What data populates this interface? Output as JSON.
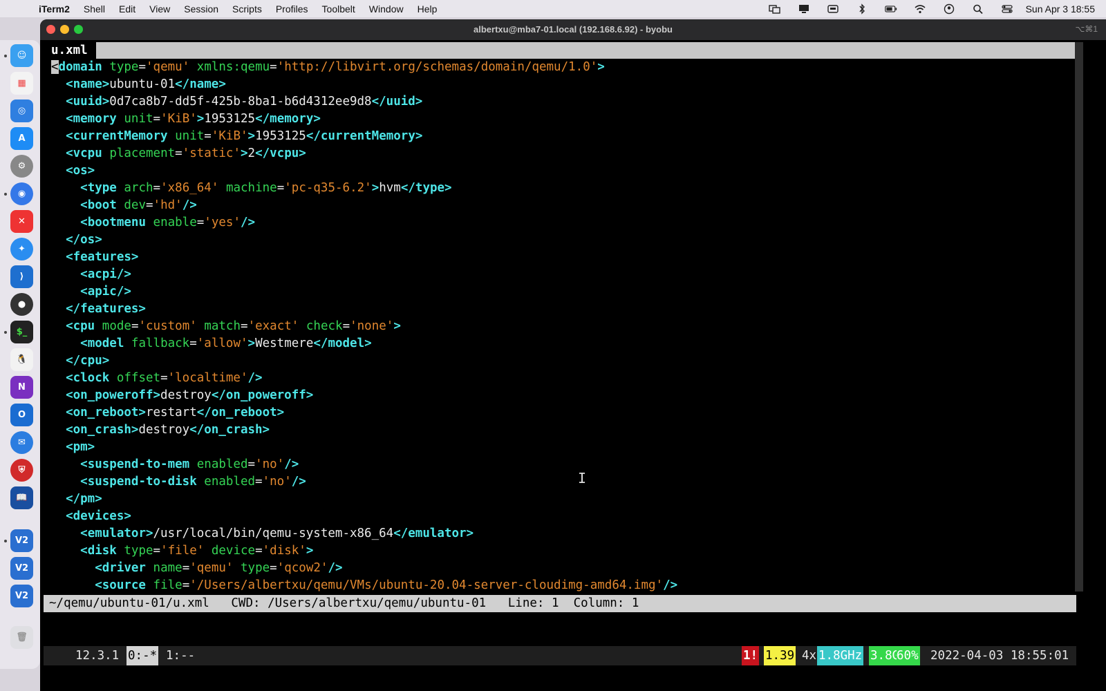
{
  "menubar": {
    "app_name": "iTerm2",
    "items": [
      "Shell",
      "Edit",
      "View",
      "Session",
      "Scripts",
      "Profiles",
      "Toolbelt",
      "Window",
      "Help"
    ],
    "clock": "Sun Apr 3  18:55"
  },
  "window": {
    "title": "albertxu@mba7-01.local (192.168.6.92) - byobu",
    "shortcut": "⌥⌘1"
  },
  "editor": {
    "tab_name": "u.xml",
    "lines": [
      [
        [
          "cursor",
          "<"
        ],
        [
          "tg",
          "domain"
        ],
        [
          "tx",
          " "
        ],
        [
          "at",
          "type"
        ],
        [
          "tx",
          "="
        ],
        [
          "vl",
          "'qemu'"
        ],
        [
          "tx",
          " "
        ],
        [
          "at",
          "xmlns:qemu"
        ],
        [
          "tx",
          "="
        ],
        [
          "vl",
          "'http://libvirt.org/schemas/domain/qemu/1.0'"
        ],
        [
          "tg",
          ">"
        ]
      ],
      [
        [
          "tx",
          "  "
        ],
        [
          "tg",
          "<name>"
        ],
        [
          "tx",
          "ubuntu-01"
        ],
        [
          "tg",
          "</name>"
        ]
      ],
      [
        [
          "tx",
          "  "
        ],
        [
          "tg",
          "<uuid>"
        ],
        [
          "tx",
          "0d7ca8b7-dd5f-425b-8ba1-b6d4312ee9d8"
        ],
        [
          "tg",
          "</uuid>"
        ]
      ],
      [
        [
          "tx",
          "  "
        ],
        [
          "tg",
          "<memory"
        ],
        [
          "tx",
          " "
        ],
        [
          "at",
          "unit"
        ],
        [
          "tx",
          "="
        ],
        [
          "vl",
          "'KiB'"
        ],
        [
          "tg",
          ">"
        ],
        [
          "tx",
          "1953125"
        ],
        [
          "tg",
          "</memory>"
        ]
      ],
      [
        [
          "tx",
          "  "
        ],
        [
          "tg",
          "<currentMemory"
        ],
        [
          "tx",
          " "
        ],
        [
          "at",
          "unit"
        ],
        [
          "tx",
          "="
        ],
        [
          "vl",
          "'KiB'"
        ],
        [
          "tg",
          ">"
        ],
        [
          "tx",
          "1953125"
        ],
        [
          "tg",
          "</currentMemory>"
        ]
      ],
      [
        [
          "tx",
          "  "
        ],
        [
          "tg",
          "<vcpu"
        ],
        [
          "tx",
          " "
        ],
        [
          "at",
          "placement"
        ],
        [
          "tx",
          "="
        ],
        [
          "vl",
          "'static'"
        ],
        [
          "tg",
          ">"
        ],
        [
          "tx",
          "2"
        ],
        [
          "tg",
          "</vcpu>"
        ]
      ],
      [
        [
          "tx",
          "  "
        ],
        [
          "tg",
          "<os>"
        ]
      ],
      [
        [
          "tx",
          "    "
        ],
        [
          "tg",
          "<type"
        ],
        [
          "tx",
          " "
        ],
        [
          "at",
          "arch"
        ],
        [
          "tx",
          "="
        ],
        [
          "vl",
          "'x86_64'"
        ],
        [
          "tx",
          " "
        ],
        [
          "at",
          "machine"
        ],
        [
          "tx",
          "="
        ],
        [
          "vl",
          "'pc-q35-6.2'"
        ],
        [
          "tg",
          ">"
        ],
        [
          "tx",
          "hvm"
        ],
        [
          "tg",
          "</type>"
        ]
      ],
      [
        [
          "tx",
          "    "
        ],
        [
          "tg",
          "<boot"
        ],
        [
          "tx",
          " "
        ],
        [
          "at",
          "dev"
        ],
        [
          "tx",
          "="
        ],
        [
          "vl",
          "'hd'"
        ],
        [
          "tg",
          "/>"
        ]
      ],
      [
        [
          "tx",
          "    "
        ],
        [
          "tg",
          "<bootmenu"
        ],
        [
          "tx",
          " "
        ],
        [
          "at",
          "enable"
        ],
        [
          "tx",
          "="
        ],
        [
          "vl",
          "'yes'"
        ],
        [
          "tg",
          "/>"
        ]
      ],
      [
        [
          "tx",
          "  "
        ],
        [
          "tg",
          "</os>"
        ]
      ],
      [
        [
          "tx",
          "  "
        ],
        [
          "tg",
          "<features>"
        ]
      ],
      [
        [
          "tx",
          "    "
        ],
        [
          "tg",
          "<acpi/>"
        ]
      ],
      [
        [
          "tx",
          "    "
        ],
        [
          "tg",
          "<apic/>"
        ]
      ],
      [
        [
          "tx",
          "  "
        ],
        [
          "tg",
          "</features>"
        ]
      ],
      [
        [
          "tx",
          "  "
        ],
        [
          "tg",
          "<cpu"
        ],
        [
          "tx",
          " "
        ],
        [
          "at",
          "mode"
        ],
        [
          "tx",
          "="
        ],
        [
          "vl",
          "'custom'"
        ],
        [
          "tx",
          " "
        ],
        [
          "at",
          "match"
        ],
        [
          "tx",
          "="
        ],
        [
          "vl",
          "'exact'"
        ],
        [
          "tx",
          " "
        ],
        [
          "at",
          "check"
        ],
        [
          "tx",
          "="
        ],
        [
          "vl",
          "'none'"
        ],
        [
          "tg",
          ">"
        ]
      ],
      [
        [
          "tx",
          "    "
        ],
        [
          "tg",
          "<model"
        ],
        [
          "tx",
          " "
        ],
        [
          "at",
          "fallback"
        ],
        [
          "tx",
          "="
        ],
        [
          "vl",
          "'allow'"
        ],
        [
          "tg",
          ">"
        ],
        [
          "tx",
          "Westmere"
        ],
        [
          "tg",
          "</model>"
        ]
      ],
      [
        [
          "tx",
          "  "
        ],
        [
          "tg",
          "</cpu>"
        ]
      ],
      [
        [
          "tx",
          "  "
        ],
        [
          "tg",
          "<clock"
        ],
        [
          "tx",
          " "
        ],
        [
          "at",
          "offset"
        ],
        [
          "tx",
          "="
        ],
        [
          "vl",
          "'localtime'"
        ],
        [
          "tg",
          "/>"
        ]
      ],
      [
        [
          "tx",
          "  "
        ],
        [
          "tg",
          "<on_poweroff>"
        ],
        [
          "tx",
          "destroy"
        ],
        [
          "tg",
          "</on_poweroff>"
        ]
      ],
      [
        [
          "tx",
          "  "
        ],
        [
          "tg",
          "<on_reboot>"
        ],
        [
          "tx",
          "restart"
        ],
        [
          "tg",
          "</on_reboot>"
        ]
      ],
      [
        [
          "tx",
          "  "
        ],
        [
          "tg",
          "<on_crash>"
        ],
        [
          "tx",
          "destroy"
        ],
        [
          "tg",
          "</on_crash>"
        ]
      ],
      [
        [
          "tx",
          "  "
        ],
        [
          "tg",
          "<pm>"
        ]
      ],
      [
        [
          "tx",
          "    "
        ],
        [
          "tg",
          "<suspend-to-mem"
        ],
        [
          "tx",
          " "
        ],
        [
          "at",
          "enabled"
        ],
        [
          "tx",
          "="
        ],
        [
          "vl",
          "'no'"
        ],
        [
          "tg",
          "/>"
        ]
      ],
      [
        [
          "tx",
          "    "
        ],
        [
          "tg",
          "<suspend-to-disk"
        ],
        [
          "tx",
          " "
        ],
        [
          "at",
          "enabled"
        ],
        [
          "tx",
          "="
        ],
        [
          "vl",
          "'no'"
        ],
        [
          "tg",
          "/>"
        ]
      ],
      [
        [
          "tx",
          "  "
        ],
        [
          "tg",
          "</pm>"
        ]
      ],
      [
        [
          "tx",
          "  "
        ],
        [
          "tg",
          "<devices>"
        ]
      ],
      [
        [
          "tx",
          "    "
        ],
        [
          "tg",
          "<emulator>"
        ],
        [
          "tx",
          "/usr/local/bin/qemu-system-x86_64"
        ],
        [
          "tg",
          "</emulator>"
        ]
      ],
      [
        [
          "tx",
          "    "
        ],
        [
          "tg",
          "<disk"
        ],
        [
          "tx",
          " "
        ],
        [
          "at",
          "type"
        ],
        [
          "tx",
          "="
        ],
        [
          "vl",
          "'file'"
        ],
        [
          "tx",
          " "
        ],
        [
          "at",
          "device"
        ],
        [
          "tx",
          "="
        ],
        [
          "vl",
          "'disk'"
        ],
        [
          "tg",
          ">"
        ]
      ],
      [
        [
          "tx",
          "      "
        ],
        [
          "tg",
          "<driver"
        ],
        [
          "tx",
          " "
        ],
        [
          "at",
          "name"
        ],
        [
          "tx",
          "="
        ],
        [
          "vl",
          "'qemu'"
        ],
        [
          "tx",
          " "
        ],
        [
          "at",
          "type"
        ],
        [
          "tx",
          "="
        ],
        [
          "vl",
          "'qcow2'"
        ],
        [
          "tg",
          "/>"
        ]
      ],
      [
        [
          "tx",
          "      "
        ],
        [
          "tg",
          "<source"
        ],
        [
          "tx",
          " "
        ],
        [
          "at",
          "file"
        ],
        [
          "tx",
          "="
        ],
        [
          "vl",
          "'/Users/albertxu/qemu/VMs/ubuntu-20.04-server-cloudimg-amd64.img'"
        ],
        [
          "tg",
          "/>"
        ]
      ]
    ],
    "status_line": "~/qemu/ubuntu-01/u.xml   CWD: /Users/albertxu/qemu/ubuntu-01   Line: 1  Column: 1"
  },
  "byobu": {
    "os_version": "12.3.1",
    "window_active": "0:-*",
    "window_other": "1:--",
    "alerts": "1!",
    "load": "1.39",
    "cpu_count": "4x",
    "cpu_freq": "1.8GHz",
    "memory": "3.8G",
    "memory_pct": "60%",
    "datetime": "2022-04-03 18:55:01"
  },
  "colors": {
    "tag": "#4ee6e8",
    "attribute": "#35d455",
    "value": "#e2882f",
    "text": "#ececec"
  }
}
